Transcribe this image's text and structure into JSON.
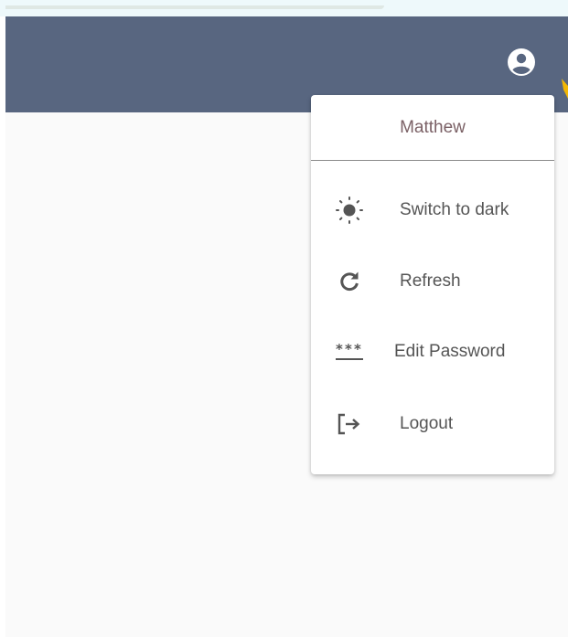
{
  "colors": {
    "appbar": "#586680",
    "menu_bg": "#ffffff",
    "header_text": "#7b6166",
    "item_text": "#555555",
    "icon": "#555555",
    "accent": "#f2b705"
  },
  "appbar": {
    "account_icon": "account-circle-icon"
  },
  "menu": {
    "user_name": "Matthew",
    "items": [
      {
        "label": "Switch to dark",
        "icon": "sun-icon"
      },
      {
        "label": "Refresh",
        "icon": "refresh-icon"
      },
      {
        "label": "Edit Password",
        "icon": "password-icon"
      },
      {
        "label": "Logout",
        "icon": "logout-icon"
      }
    ]
  }
}
